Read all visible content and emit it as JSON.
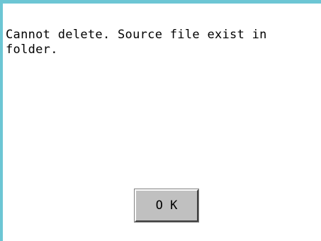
{
  "dialog": {
    "message": "Cannot delete. Source file exist in\nfolder.",
    "ok_label": "O K"
  },
  "colors": {
    "frame": "#6cc6d4",
    "button_face": "#c0c0c0",
    "text": "#000000",
    "background": "#ffffff"
  }
}
